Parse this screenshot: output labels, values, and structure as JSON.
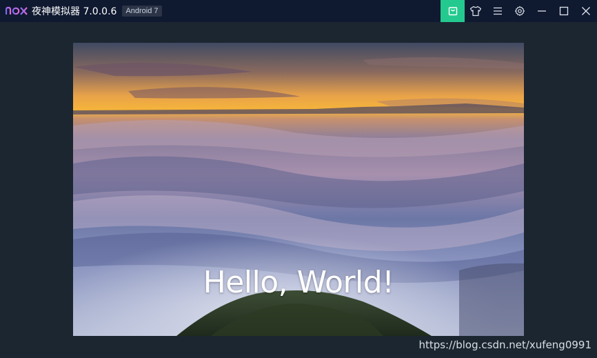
{
  "titlebar": {
    "logo_text": "nox",
    "app_title": "夜神模拟器 7.0.0.6",
    "android_badge": "Android 7",
    "buttons": [
      {
        "icon": "shopping-bag-icon"
      },
      {
        "icon": "shirt-icon"
      },
      {
        "icon": "menu-icon"
      },
      {
        "icon": "gear-icon"
      },
      {
        "icon": "minimize-icon"
      },
      {
        "icon": "maximize-icon"
      },
      {
        "icon": "close-icon"
      }
    ],
    "store_accent_color": "#24c98f"
  },
  "screen": {
    "background_description_icon": "sea-of-clouds-wallpaper",
    "hello_text": "Hello, World!"
  },
  "watermark": "https://blog.csdn.net/xufeng0991"
}
